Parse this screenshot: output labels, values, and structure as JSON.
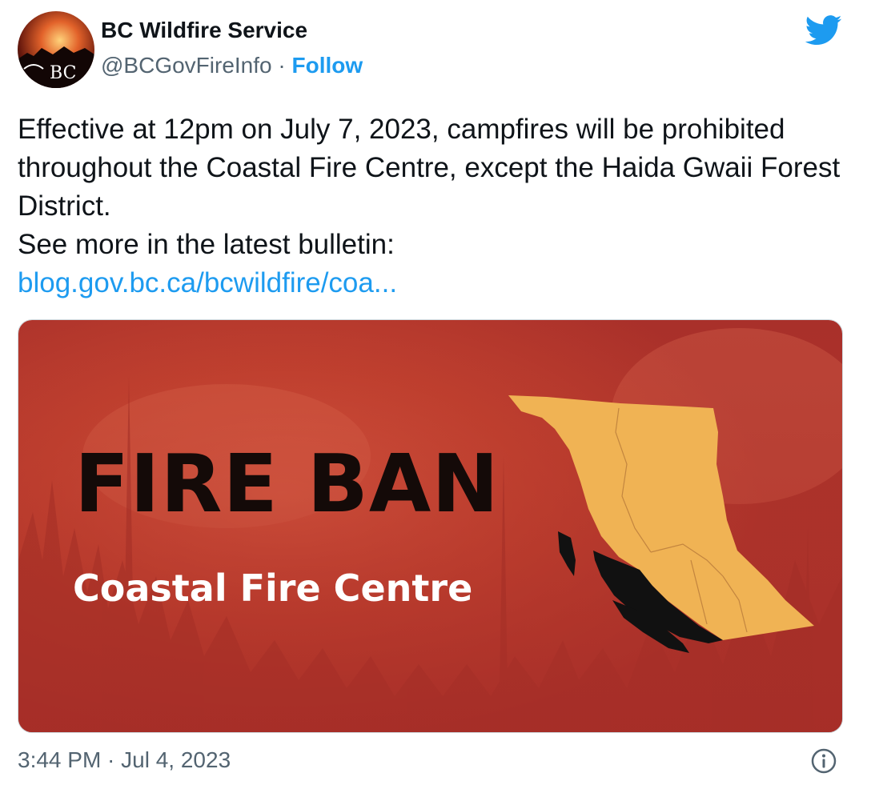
{
  "author": {
    "display_name": "BC Wildfire Service",
    "handle": "@BCGovFireInfo",
    "separator": "·",
    "follow_label": "Follow",
    "avatar_text": "BC"
  },
  "tweet": {
    "lines": [
      "Effective at 12pm on July 7, 2023, campfires will be prohibited throughout the Coastal Fire Centre, except the Haida Gwaii Forest District.",
      "See more in the latest bulletin:"
    ],
    "link_text": "blog.gov.bc.ca/bcwildfire/coa..."
  },
  "media": {
    "headline": "FIRE BAN",
    "subheadline": "Coastal Fire Centre"
  },
  "footer": {
    "timestamp": "3:44 PM · Jul 4, 2023"
  },
  "icons": {
    "brand": "twitter-bird-icon",
    "info": "info-icon"
  },
  "colors": {
    "accent": "#1d9bf0",
    "banner_red": "#b8392c",
    "province": "#f0b354",
    "coastal_region": "#111111"
  }
}
